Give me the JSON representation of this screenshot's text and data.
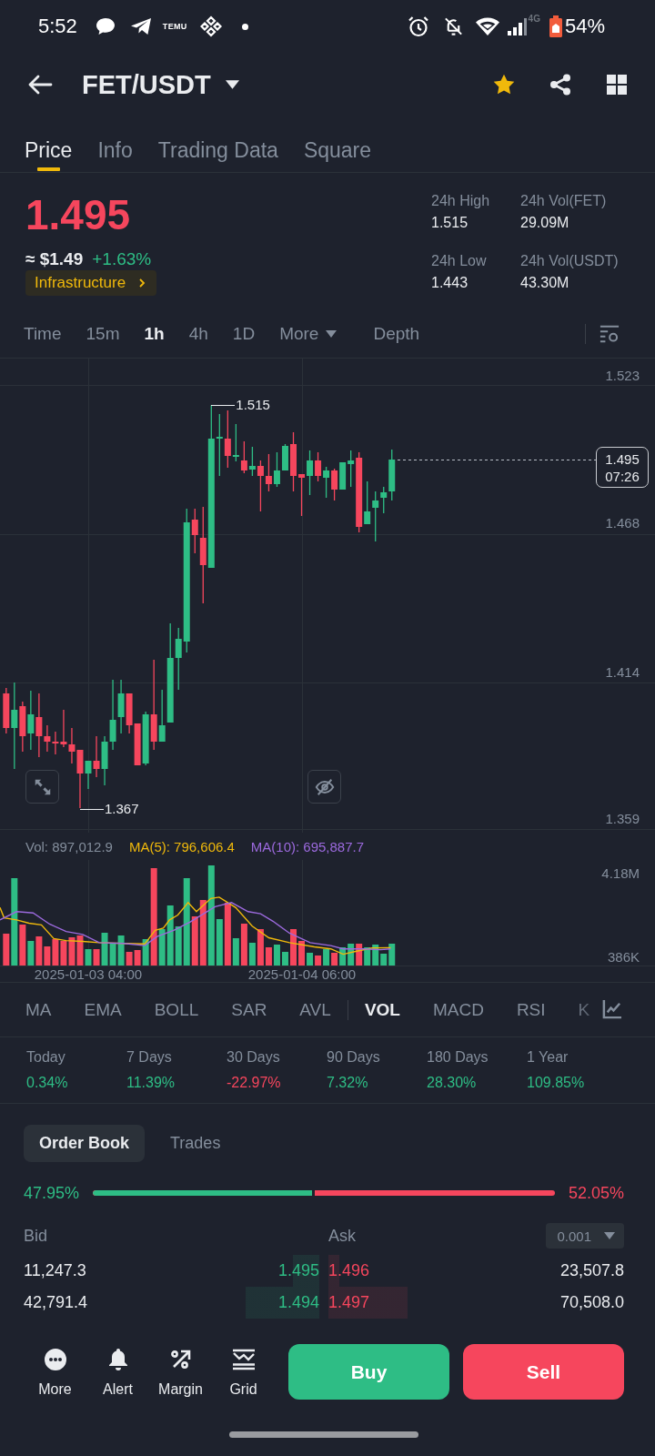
{
  "status_bar": {
    "time": "5:52",
    "app_label": "TEMU",
    "network": "4G",
    "battery": "54%"
  },
  "header": {
    "pair": "FET/USDT",
    "favorite": true
  },
  "tabs": [
    {
      "label": "Price",
      "selected": true
    },
    {
      "label": "Info",
      "selected": false
    },
    {
      "label": "Trading Data",
      "selected": false
    },
    {
      "label": "Square",
      "selected": false
    }
  ],
  "ticker": {
    "price": "1.495",
    "price_up": false,
    "fiat_price": "≈ $1.49",
    "change": "+1.63%",
    "change_up": true,
    "tag": "Infrastructure",
    "stats": [
      {
        "label": "24h High",
        "value": "1.515"
      },
      {
        "label": "24h Vol(FET)",
        "value": "29.09M"
      },
      {
        "label": "24h Low",
        "value": "1.443"
      },
      {
        "label": "24h Vol(USDT)",
        "value": "43.30M"
      }
    ]
  },
  "intervals": [
    {
      "label": "Time",
      "kind": "option",
      "selected": false
    },
    {
      "label": "15m",
      "kind": "option",
      "selected": false
    },
    {
      "label": "1h",
      "kind": "option",
      "selected": true
    },
    {
      "label": "4h",
      "kind": "option",
      "selected": false
    },
    {
      "label": "1D",
      "kind": "option",
      "selected": false
    },
    {
      "label": "More",
      "kind": "dropdown",
      "selected": false
    },
    {
      "label": "Depth",
      "kind": "option",
      "selected": false
    }
  ],
  "chart": {
    "price_axis": [
      "1.523",
      "1.468",
      "1.414",
      "1.359"
    ],
    "high_label": "1.515",
    "low_label": "1.367",
    "last_price": "1.495",
    "countdown": "07:26"
  },
  "volume": {
    "legend": [
      {
        "label": "Vol: 897,012.9",
        "color": "#848e9c"
      },
      {
        "label": "MA(5): 796,606.4",
        "color": "#f0b90b"
      },
      {
        "label": "MA(10): 695,887.7",
        "color": "#9c6ade"
      }
    ],
    "axis": [
      "4.18M",
      "386K"
    ],
    "time_axis": [
      "2025-01-03 04:00",
      "2025-01-04 06:00"
    ]
  },
  "indicators": {
    "main": [
      {
        "label": "MA",
        "selected": false
      },
      {
        "label": "EMA",
        "selected": false
      },
      {
        "label": "BOLL",
        "selected": false
      },
      {
        "label": "SAR",
        "selected": false
      },
      {
        "label": "AVL",
        "selected": false
      }
    ],
    "sub": [
      {
        "label": "VOL",
        "selected": true
      },
      {
        "label": "MACD",
        "selected": false
      },
      {
        "label": "RSI",
        "selected": false
      },
      {
        "label": "K",
        "selected": false
      }
    ]
  },
  "performance": [
    {
      "period": "Today",
      "change": "0.34%",
      "up": true
    },
    {
      "period": "7 Days",
      "change": "11.39%",
      "up": true
    },
    {
      "period": "30 Days",
      "change": "-22.97%",
      "up": false
    },
    {
      "period": "90 Days",
      "change": "7.32%",
      "up": true
    },
    {
      "period": "180 Days",
      "change": "28.30%",
      "up": true
    },
    {
      "period": "1 Year",
      "change": "109.85%",
      "up": true
    }
  ],
  "order_book": {
    "tabs": [
      {
        "label": "Order Book",
        "selected": true
      },
      {
        "label": "Trades",
        "selected": false
      }
    ],
    "buy_share": "47.95%",
    "sell_share": "52.05%",
    "level": 0.4795,
    "bid_header": "Bid",
    "ask_header": "Ask",
    "precision": "0.001",
    "rows": [
      {
        "bid": {
          "amount": "11,247.3",
          "price": "1.495"
        },
        "ask": {
          "price": "1.496",
          "amount": "23,507.8"
        }
      },
      {
        "bid": {
          "amount": "42,791.4",
          "price": "1.494"
        },
        "ask": {
          "price": "1.497",
          "amount": "70,508.0"
        }
      }
    ]
  },
  "bottom_bar": {
    "actions": [
      {
        "label": "More"
      },
      {
        "label": "Alert"
      },
      {
        "label": "Margin"
      },
      {
        "label": "Grid"
      }
    ],
    "buy": "Buy",
    "sell": "Sell"
  }
}
